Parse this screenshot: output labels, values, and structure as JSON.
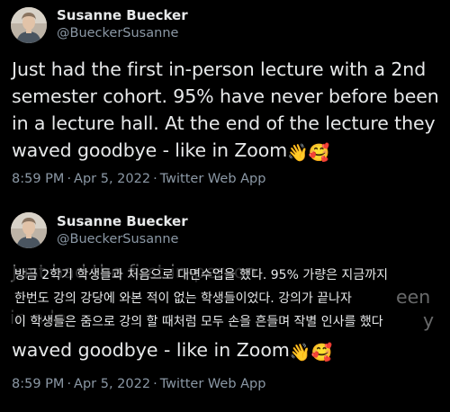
{
  "tweets": [
    {
      "author": {
        "name": "Susanne Buecker",
        "handle": "@BueckerSusanne"
      },
      "text_lines": [
        "Just had the first in-person lecture with a 2nd",
        "semester cohort. 95% have never before been",
        "in a lecture hall. At the end of the lecture they",
        "waved goodbye - like in Zoom"
      ],
      "emojis": [
        "👋",
        "🥰"
      ],
      "time": "8:59 PM",
      "date": "Apr 5, 2022",
      "source": "Twitter Web App",
      "separator": "·"
    },
    {
      "author": {
        "name": "Susanne Buecker",
        "handle": "@BueckerSusanne"
      },
      "translation_lines": [
        "방금 2학기 학생들과 처음으로 대면수업을 했다. 95% 가량은 지금까지",
        "한번도 강의 강당에 와본 적이 없는 학생들이었다. 강의가 끝나자",
        "이 학생들은 줌으로 강의 할 때처럼 모두 손을 흔들며 작별 인사를 했다"
      ],
      "ghost_fragments": [
        "Just had the first in-person",
        "een",
        "y",
        "in a le"
      ],
      "last_line": "waved goodbye - like in Zoom",
      "emojis": [
        "👋",
        "🥰"
      ],
      "time": "8:59 PM",
      "date": "Apr 5, 2022",
      "source": "Twitter Web App",
      "separator": "·"
    }
  ]
}
